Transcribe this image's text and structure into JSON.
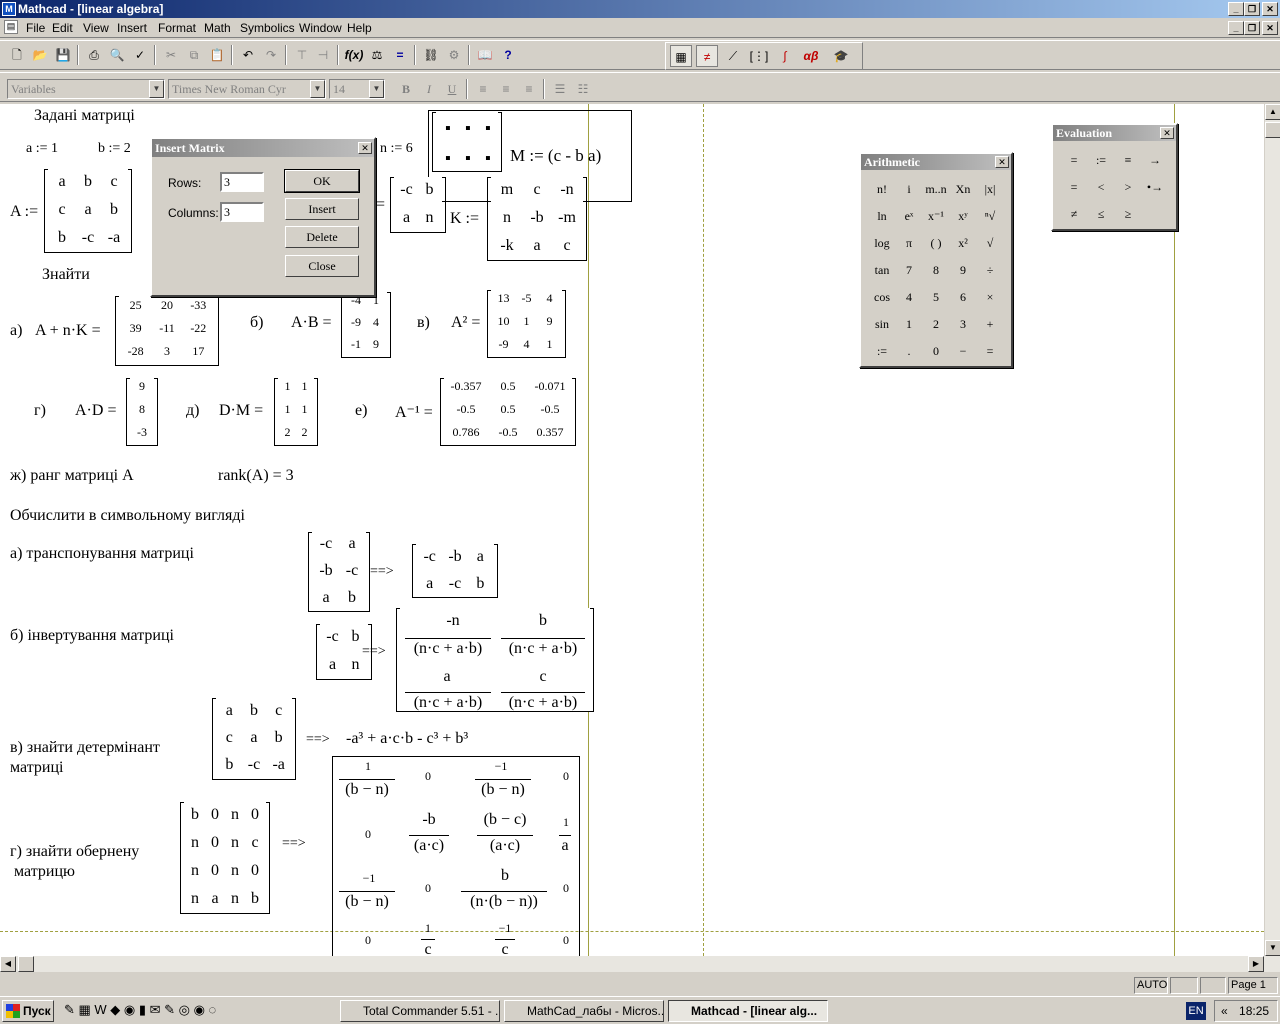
{
  "title": "Mathcad - [linear algebra]",
  "menu": [
    "File",
    "Edit",
    "View",
    "Insert",
    "Format",
    "Math",
    "Symbolics",
    "Window",
    "Help"
  ],
  "format": {
    "style": "Variables",
    "font": "Times New Roman Cyr",
    "size": "14"
  },
  "doc": {
    "heading1": "Задані матриці",
    "a_def": "a := 1",
    "b_def": "b := 2",
    "n_def": "n := 6",
    "M_def": "M := (c - b a)",
    "A_label": "A :=",
    "A_rows": [
      [
        "a",
        "b",
        "c"
      ],
      [
        "c",
        "a",
        "b"
      ],
      [
        "b",
        "-c",
        "-a"
      ]
    ],
    "D_partial": "=",
    "D_rows": [
      [
        "-c",
        "b"
      ],
      [
        "a",
        "n"
      ]
    ],
    "K_label": "K :=",
    "K_rows": [
      [
        "m",
        "c",
        "-n"
      ],
      [
        "n",
        "-b",
        "-m"
      ],
      [
        "-k",
        "a",
        "c"
      ]
    ],
    "heading2": "Знайти",
    "pa": "а)",
    "pa_expr": "A + n·K =",
    "pa_rows": [
      [
        "25",
        "20",
        "-33"
      ],
      [
        "39",
        "-11",
        "-22"
      ],
      [
        "-28",
        "3",
        "17"
      ]
    ],
    "pb": "б)",
    "pb_expr": "A·B =",
    "pb_rows": [
      [
        "-4",
        "1"
      ],
      [
        "-9",
        "4"
      ],
      [
        "-1",
        "9"
      ]
    ],
    "pv": "в)",
    "pv_expr": "A² =",
    "pv_rows": [
      [
        "13",
        "-5",
        "4"
      ],
      [
        "10",
        "1",
        "9"
      ],
      [
        "-9",
        "4",
        "1"
      ]
    ],
    "pg": "г)",
    "pg_expr": "A·D =",
    "pg_rows": [
      [
        "9"
      ],
      [
        "8"
      ],
      [
        "-3"
      ]
    ],
    "pd": "д)",
    "pd_expr": "D·M =",
    "pd_rows": [
      [
        "1",
        "1"
      ],
      [
        "1",
        "1"
      ],
      [
        "2",
        "2"
      ]
    ],
    "pe": "е)",
    "pe_expr": "A⁻¹ =",
    "pe_rows": [
      [
        "-0.357",
        "0.5",
        "-0.071"
      ],
      [
        "-0.5",
        "0.5",
        "-0.5"
      ],
      [
        "0.786",
        "-0.5",
        "0.357"
      ]
    ],
    "rank_label": "ж) ранг матриці A",
    "rank_expr": "rank(A) = 3",
    "heading3": "Обчислити в символьному вигляді",
    "s1": "а) транспонування матриці",
    "s1_in": [
      [
        "-c",
        "a"
      ],
      [
        "-b",
        "-c"
      ],
      [
        "a",
        "b"
      ]
    ],
    "s1_out": [
      [
        "-c",
        "-b",
        "a"
      ],
      [
        "a",
        "-c",
        "b"
      ]
    ],
    "s2": "б) інвертування матриці",
    "s2_in": [
      [
        "-c",
        "b"
      ],
      [
        "a",
        "n"
      ]
    ],
    "s2_out": [
      [
        "-n",
        "(n·c + a·b)",
        "b",
        "(n·c + a·b)"
      ],
      [
        "a",
        "(n·c + a·b)",
        "c",
        "(n·c + a·b)"
      ]
    ],
    "s3a": "в) знайти детермінант",
    "s3b": "матриці",
    "s3_in": [
      [
        "a",
        "b",
        "c"
      ],
      [
        "c",
        "a",
        "b"
      ],
      [
        "b",
        "-c",
        "-a"
      ]
    ],
    "s3_out": "-a³ + a·c·b - c³ + b³",
    "s4a": "г) знайти обернену",
    "s4b": "матрицю",
    "s4_in": [
      [
        "b",
        "0",
        "n",
        "0"
      ],
      [
        "n",
        "0",
        "n",
        "c"
      ],
      [
        "n",
        "0",
        "n",
        "0"
      ],
      [
        "n",
        "a",
        "n",
        "b"
      ]
    ],
    "arrow": "==>"
  },
  "insert_matrix": {
    "title": "Insert Matrix",
    "rows_label": "Rows:",
    "rows_value": "3",
    "cols_label": "Columns:",
    "cols_value": "3",
    "ok": "OK",
    "insert": "Insert",
    "delete": "Delete",
    "close": "Close"
  },
  "arithmetic": {
    "title": "Arithmetic",
    "buttons": [
      "n!",
      "i",
      "m..n",
      "Xn",
      "|x|",
      "ln",
      "eˣ",
      "x⁻¹",
      "xʸ",
      "ⁿ√",
      "log",
      "π",
      "( )",
      "x²",
      "√",
      "tan",
      "7",
      "8",
      "9",
      "÷",
      "cos",
      "4",
      "5",
      "6",
      "×",
      "sin",
      "1",
      "2",
      "3",
      "+",
      ":=",
      ".",
      "0",
      "−",
      "="
    ]
  },
  "evaluation": {
    "title": "Evaluation",
    "buttons": [
      "=",
      ":=",
      "≡",
      "→",
      "=",
      "<",
      ">",
      "•→",
      "≠",
      "≤",
      "≥"
    ]
  },
  "status": {
    "mode": "AUTO",
    "page": "Page 1"
  },
  "taskbar": {
    "start": "Пуск",
    "tasks": [
      "Total Commander 5.51 - ...",
      "MathCad_лабы - Micros...",
      "Mathcad - [linear alg..."
    ],
    "lang": "EN",
    "time": "18:25"
  }
}
